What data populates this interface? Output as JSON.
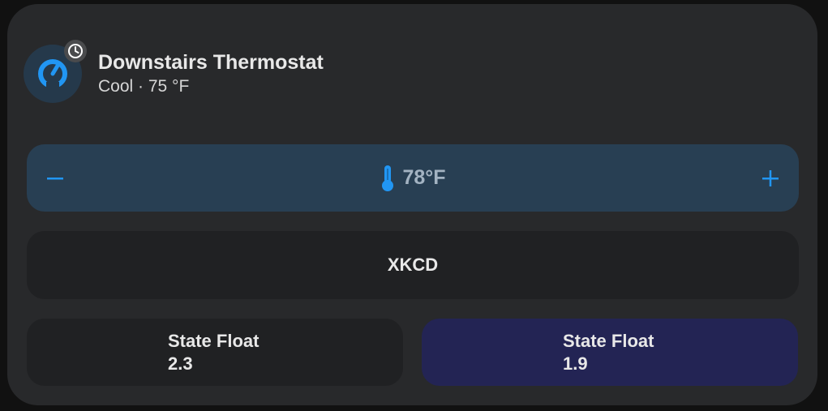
{
  "card": {
    "title": "Downstairs Thermostat",
    "subtitle": "Cool · 75 °F",
    "icon": "thermostat-gauge-icon",
    "badge_icon": "clock-icon"
  },
  "thermostat": {
    "decrease_icon": "minus-icon",
    "increase_icon": "plus-icon",
    "temperature_icon": "thermometer-icon",
    "setpoint": "78°F"
  },
  "buttons": {
    "xkcd_label": "XKCD",
    "state_floats": [
      {
        "label": "State Float",
        "value": "2.3"
      },
      {
        "label": "State Float",
        "value": "1.9"
      }
    ]
  },
  "colors": {
    "accent": "#2196f3",
    "card_background": "#28292b",
    "temp_row_background": "#283f53",
    "highlight_button": "#232454"
  }
}
